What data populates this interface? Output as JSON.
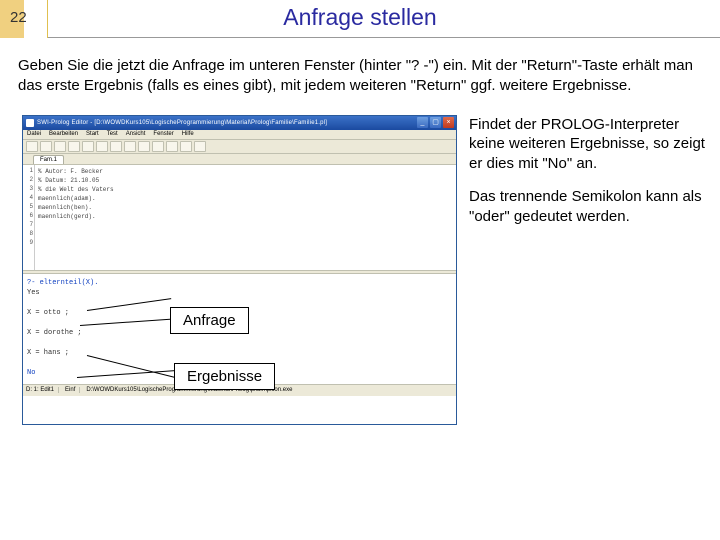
{
  "page_number": "22",
  "title": "Anfrage stellen",
  "intro": "Geben Sie die jetzt die Anfrage im unteren Fenster (hinter \"? -\") ein. Mit der \"Return\"-Taste erhält man das erste Ergebnis (falls es eines gibt), mit jedem weiteren \"Return\" ggf. weitere Ergebnisse.",
  "side_para_1": "Findet der PROLOG-Interpreter keine weiteren Ergebnisse, so zeigt er dies mit \"No\" an.",
  "side_para_2": "Das trennende Semikolon kann als \"oder\" gedeutet werden.",
  "callouts": {
    "anfrage": "Anfrage",
    "ergebnisse": "Ergebnisse"
  },
  "app": {
    "title": "SWI-Prolog Editor - [D:\\WOWDKurs105\\LogischeProgrammierung\\Material\\Prolog\\Familie\\Familie1.pl]",
    "menu": [
      "Datei",
      "Bearbeiten",
      "Start",
      "Test",
      "Ansicht",
      "Fenster",
      "Hilfe"
    ],
    "tab": "Fam.1",
    "linenos": [
      "1",
      "2",
      "3",
      "4",
      "5",
      "6",
      "7",
      "8",
      "9"
    ],
    "editor_lines": [
      "",
      "% Autor: F. Becker",
      "% Datum: 21.10.05",
      "",
      "% die Welt des Vaters",
      "",
      "maennlich(adam).",
      "maennlich(ben).",
      "maennlich(gerd)."
    ],
    "repl_query": "?- elternteil(X).",
    "repl_lines": [
      "Yes",
      "",
      "X = otto ;",
      "",
      "X = dorothe ;",
      "",
      "X = hans ;",
      "",
      "No"
    ],
    "status": {
      "left": "D:    1: Edit1",
      "mid": "Einf",
      "path": "D:\\WOWDKurs105\\LogischeProgrammierung\\Material\\Prolog\\pl\\bin\\plcon.exe"
    }
  }
}
